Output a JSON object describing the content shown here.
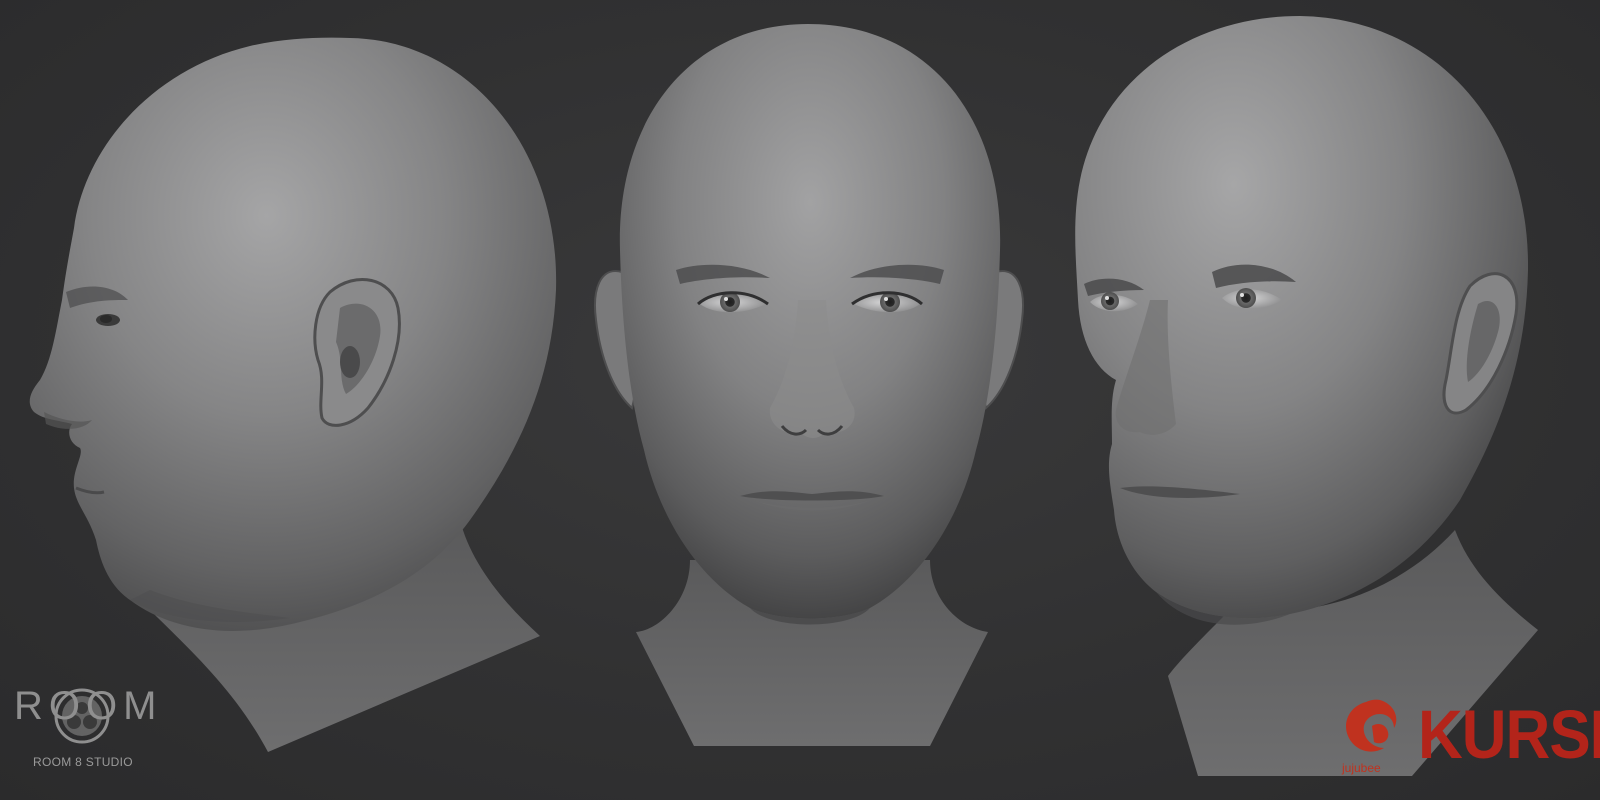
{
  "scene": {
    "background_color": "#333333",
    "views": [
      {
        "id": "profile-left",
        "description": "side"
      },
      {
        "id": "front",
        "description": "front"
      },
      {
        "id": "three-quarter-right",
        "description": "three-quarter"
      }
    ],
    "skin_color": "#7d7d7e"
  },
  "logos": {
    "room8": {
      "wordmark": "ROOM",
      "digit": "8",
      "subtitle": "ROOM 8 STUDIO",
      "color": "#8f8f8f"
    },
    "jujubee": {
      "wordmark": "jujubee",
      "color": "#c0321f"
    },
    "kursk": {
      "wordmark": "KURSK",
      "color": "#b3241a"
    }
  }
}
